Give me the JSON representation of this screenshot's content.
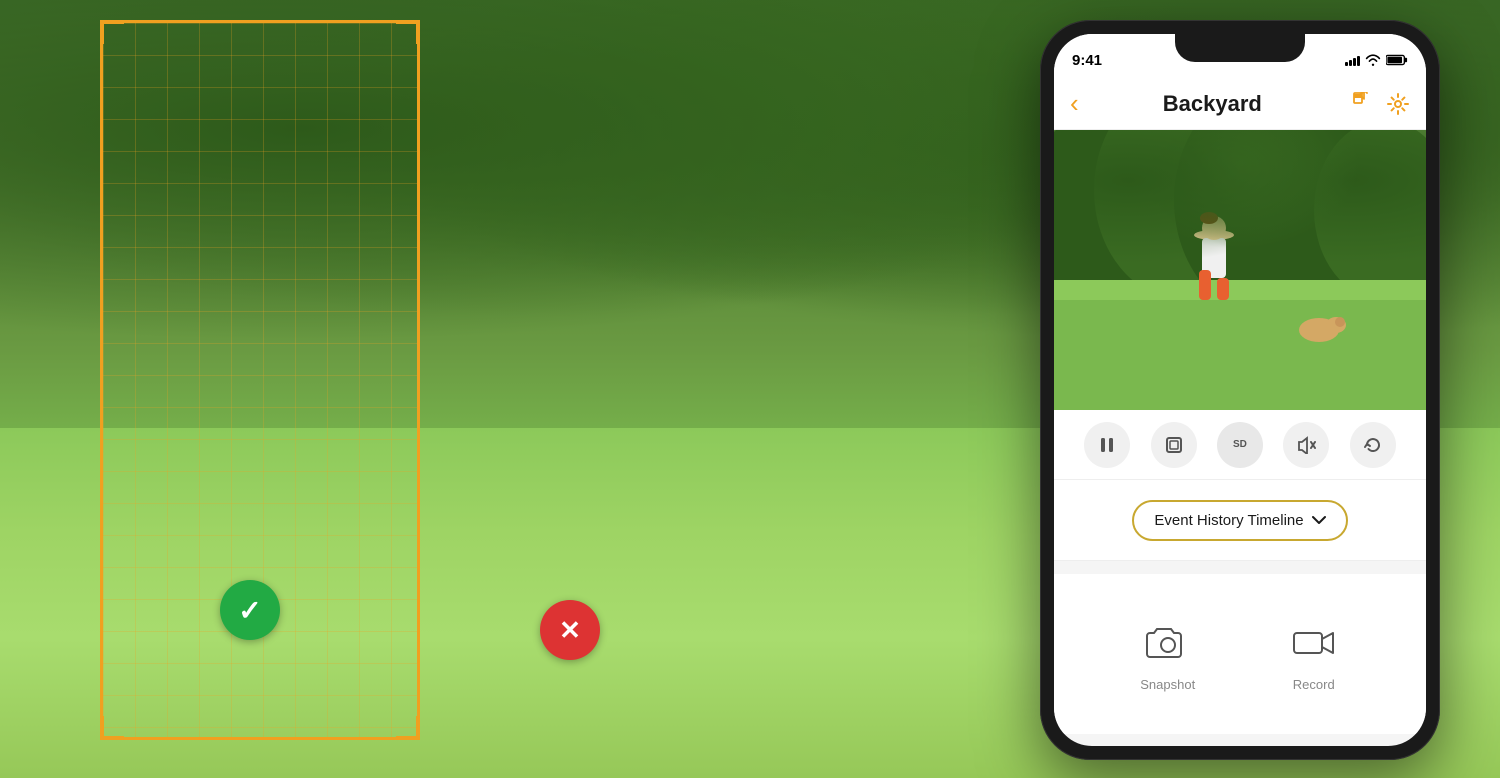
{
  "background": {
    "colors": {
      "sky": "#3d6b28",
      "grass": "#8cc95a",
      "accent_orange": "#f0a020",
      "accent_green": "#22aa44",
      "accent_red": "#dd3333"
    }
  },
  "phone": {
    "status_bar": {
      "time": "9:41",
      "signal_label": "signal-icon",
      "wifi_label": "wifi-icon",
      "battery_label": "battery-icon"
    },
    "header": {
      "back_label": "‹",
      "title": "Backyard",
      "share_icon": "share-icon",
      "settings_icon": "gear-icon"
    },
    "controls": {
      "pause_icon": "pause-icon",
      "fullscreen_icon": "fullscreen-icon",
      "sd_icon": "sd-icon",
      "mute_icon": "mute-icon",
      "rotate_icon": "rotate-icon"
    },
    "timeline": {
      "label": "Event History Timeline",
      "chevron": "chevron-down-icon"
    },
    "actions": [
      {
        "id": "snapshot",
        "icon": "camera-icon",
        "label": "Snapshot"
      },
      {
        "id": "record",
        "icon": "video-icon",
        "label": "Record"
      }
    ]
  },
  "detection": {
    "box_color": "#f0a020",
    "check_symbol": "✓",
    "x_symbol": "✕"
  }
}
